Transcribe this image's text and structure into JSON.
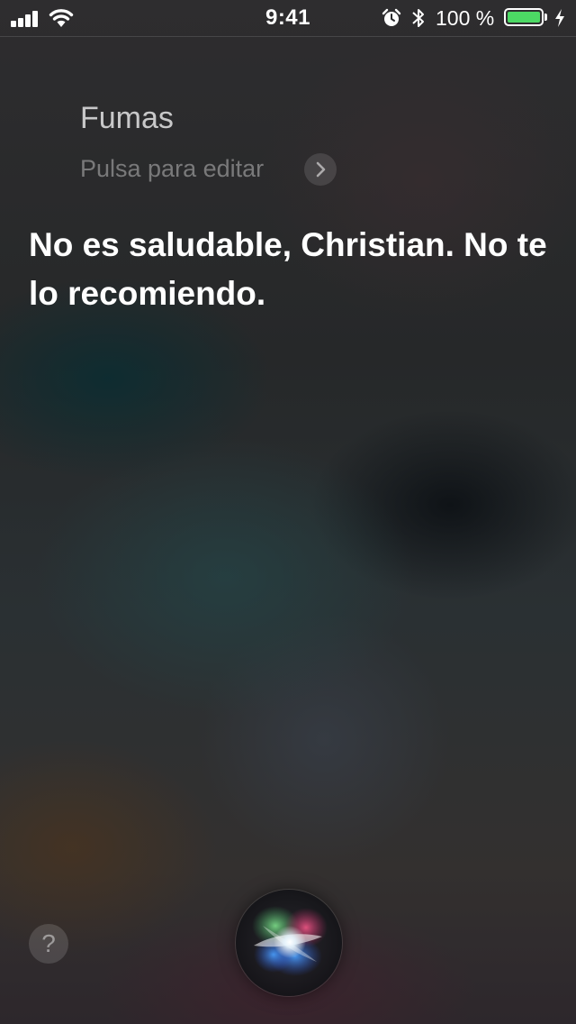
{
  "status_bar": {
    "time": "9:41",
    "battery_percent": "100 %",
    "battery_level": 1.0,
    "battery_color": "#4cd964",
    "icons": [
      "signal-icon",
      "wifi-icon",
      "alarm-icon",
      "bluetooth-icon",
      "battery-icon",
      "charging-bolt-icon"
    ]
  },
  "siri": {
    "query": "Fumas",
    "edit_hint": "Pulsa para editar",
    "response": "No es saludable, Christian. No te lo recomiendo."
  },
  "bottom": {
    "help_label": "?",
    "help_icon": "question-mark-icon",
    "siri_icon": "siri-orb-icon"
  }
}
